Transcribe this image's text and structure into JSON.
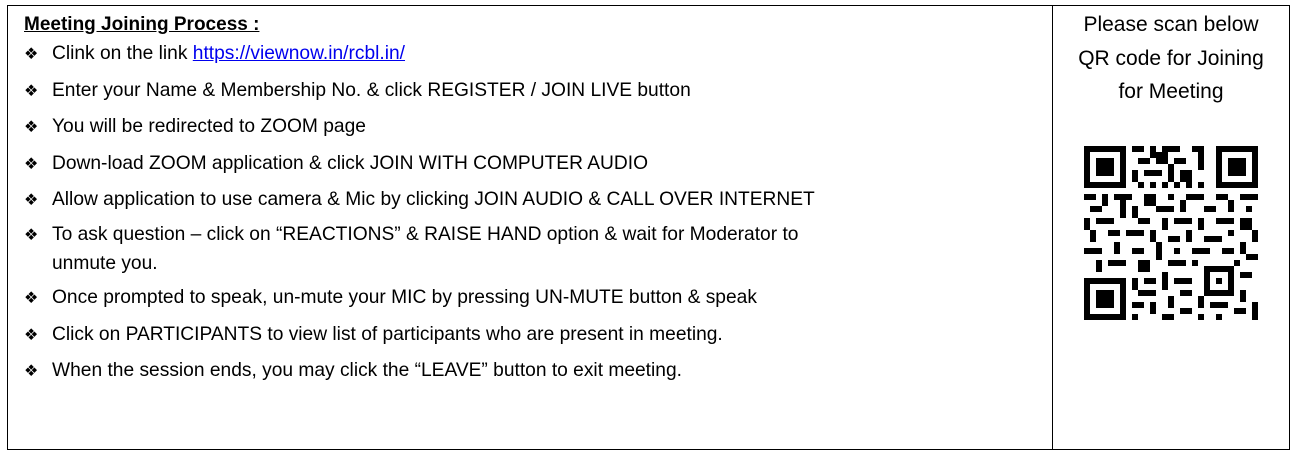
{
  "heading": "Meeting Joining Process :",
  "bullet_icon": "four-diamond-bullet",
  "steps": [
    {
      "prefix": "Clink on the link ",
      "link": "https://viewnow.in/rcbl.in/"
    },
    {
      "text": "Enter your Name & Membership No. & click REGISTER / JOIN LIVE button"
    },
    {
      "text": "You will be redirected to ZOOM page"
    },
    {
      "text": "Down-load ZOOM application & click JOIN WITH COMPUTER AUDIO"
    },
    {
      "text": "Allow application to use camera & Mic by clicking JOIN AUDIO & CALL OVER INTERNET"
    },
    {
      "text": "To ask question – click on “REACTIONS” & RAISE HAND option & wait for Moderator to unmute you."
    },
    {
      "text": "Once prompted to speak, un-mute your MIC by pressing UN-MUTE button & speak"
    },
    {
      "text": "Click on PARTICIPANTS to view list of participants who are present in meeting."
    },
    {
      "text": "When the session ends, you may click the “LEAVE” button to exit meeting."
    }
  ],
  "scan_text": "Please scan below QR code for Joining for Meeting",
  "qr_icon": "qr-code-icon",
  "link_color": "#0000ee"
}
